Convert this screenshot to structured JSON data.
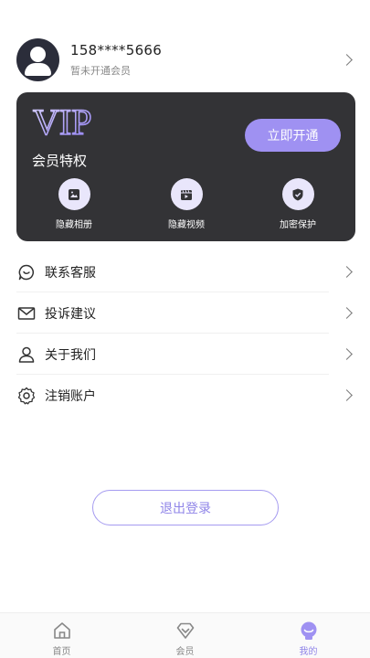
{
  "profile": {
    "phone": "158****5666",
    "status": "暂未开通会员"
  },
  "vip_card": {
    "logo_text": "VIP",
    "title": "会员特权",
    "open_button": "立即开通",
    "perks": [
      {
        "label": "隐藏相册",
        "icon": "photo-album-icon"
      },
      {
        "label": "隐藏视频",
        "icon": "video-clapper-icon"
      },
      {
        "label": "加密保护",
        "icon": "shield-check-icon"
      }
    ]
  },
  "menu": [
    {
      "label": "联系客服",
      "icon": "chat-bubble-icon"
    },
    {
      "label": "投诉建议",
      "icon": "envelope-icon"
    },
    {
      "label": "关于我们",
      "icon": "user-icon"
    },
    {
      "label": "注销账户",
      "icon": "gear-icon"
    }
  ],
  "logout_label": "退出登录",
  "tabbar": {
    "active": 2,
    "tabs": [
      {
        "label": "首页",
        "icon": "home-icon"
      },
      {
        "label": "会员",
        "icon": "diamond-icon"
      },
      {
        "label": "我的",
        "icon": "profile-face-icon"
      }
    ]
  },
  "colors": {
    "accent": "#9f91f2",
    "card_background": "#333336",
    "perk_circle": "#e9e6fb"
  }
}
